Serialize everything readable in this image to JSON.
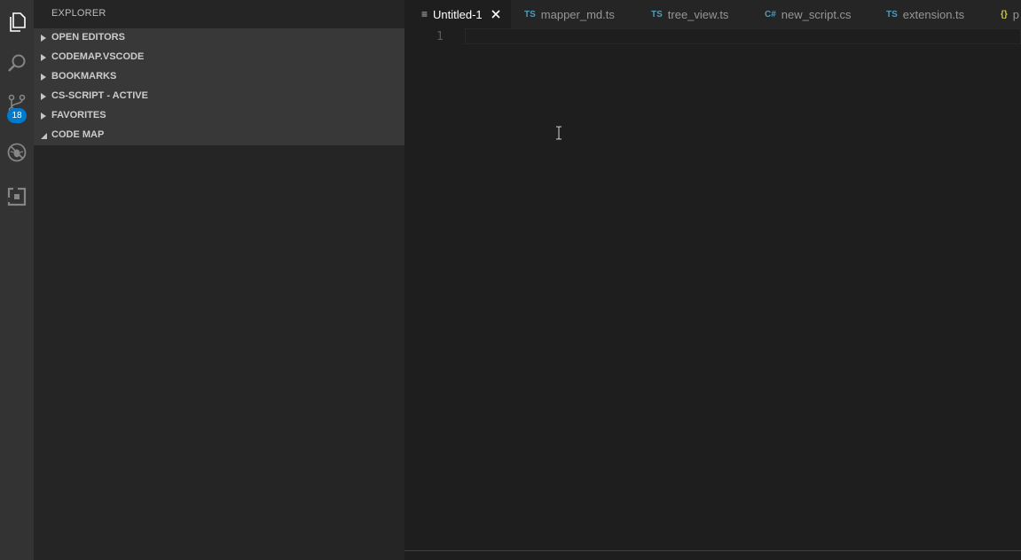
{
  "activity_bar": {
    "items": [
      {
        "name": "explorer-icon"
      },
      {
        "name": "search-icon"
      },
      {
        "name": "source-control-icon"
      },
      {
        "name": "debug-icon"
      },
      {
        "name": "extensions-icon"
      }
    ],
    "scm_badge": "18"
  },
  "sidebar": {
    "title": "EXPLORER",
    "sections": [
      {
        "label": "OPEN EDITORS",
        "expanded": false
      },
      {
        "label": "CODEMAP.VSCODE",
        "expanded": false
      },
      {
        "label": "BOOKMARKS",
        "expanded": false
      },
      {
        "label": "CS-SCRIPT - ACTIVE",
        "expanded": false
      },
      {
        "label": "FAVORITES",
        "expanded": false
      },
      {
        "label": "CODE MAP",
        "expanded": true
      }
    ]
  },
  "editor": {
    "tabs": [
      {
        "label": "Untitled-1",
        "icon": "≡",
        "icon_type": "text-file-icon",
        "active": true
      },
      {
        "label": "mapper_md.ts",
        "icon": "TS",
        "icon_type": "typescript-icon",
        "active": false
      },
      {
        "label": "tree_view.ts",
        "icon": "TS",
        "icon_type": "typescript-icon",
        "active": false
      },
      {
        "label": "new_script.cs",
        "icon": "C#",
        "icon_type": "csharp-icon",
        "active": false
      },
      {
        "label": "extension.ts",
        "icon": "TS",
        "icon_type": "typescript-icon",
        "active": false
      },
      {
        "label": "p",
        "icon": "{}",
        "icon_type": "json-icon",
        "active": false
      }
    ],
    "line_numbers": [
      "1"
    ]
  },
  "colors": {
    "accent": "#007acc",
    "ts_icon": "#519aba",
    "cs_icon": "#519aba",
    "json_icon": "#cbcb41"
  }
}
